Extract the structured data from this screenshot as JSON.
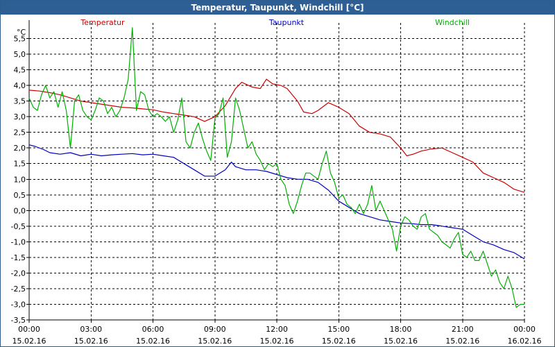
{
  "window": {
    "title": "Temperatur, Taupunkt, Windchill [°C]"
  },
  "chart_data": {
    "type": "line",
    "title": "Temperatur, Taupunkt, Windchill [°C]",
    "ylabel": "°C",
    "xlabel": "",
    "ylim": [
      -3.5,
      6.0
    ],
    "yticks": [
      "5,5",
      "5,0",
      "4,5",
      "4,0",
      "3,5",
      "3,0",
      "2,5",
      "2,0",
      "1,5",
      "1,0",
      "0,5",
      "0,0",
      "-0,5",
      "-1,0",
      "-1,5",
      "-2,0",
      "-2,5",
      "-3,0",
      "-3,5"
    ],
    "xticks": [
      {
        "time": "00:00",
        "date": "15.02.16"
      },
      {
        "time": "03:00",
        "date": "15.02.16"
      },
      {
        "time": "06:00",
        "date": "15.02.16"
      },
      {
        "time": "09:00",
        "date": "15.02.16"
      },
      {
        "time": "12:00",
        "date": "15.02.16"
      },
      {
        "time": "15:00",
        "date": "15.02.16"
      },
      {
        "time": "18:00",
        "date": "15.02.16"
      },
      {
        "time": "21:00",
        "date": "15.02.16"
      },
      {
        "time": "00:00",
        "date": "16.02.16"
      }
    ],
    "x_unit": "hours since 15.02.16 00:00",
    "grid": true,
    "legend_position": "top",
    "series": [
      {
        "name": "Temperatur",
        "color": "#cc0000",
        "points": [
          [
            0,
            3.85
          ],
          [
            0.5,
            3.82
          ],
          [
            1,
            3.77
          ],
          [
            1.5,
            3.7
          ],
          [
            2,
            3.6
          ],
          [
            2.5,
            3.5
          ],
          [
            3,
            3.45
          ],
          [
            3.5,
            3.4
          ],
          [
            4,
            3.35
          ],
          [
            4.5,
            3.3
          ],
          [
            5,
            3.28
          ],
          [
            5.5,
            3.25
          ],
          [
            6,
            3.22
          ],
          [
            6.5,
            3.15
          ],
          [
            7,
            3.1
          ],
          [
            7.5,
            3.05
          ],
          [
            8,
            3.0
          ],
          [
            8.5,
            2.85
          ],
          [
            9,
            3.0
          ],
          [
            9.5,
            3.35
          ],
          [
            10,
            3.9
          ],
          [
            10.3,
            4.1
          ],
          [
            10.8,
            3.95
          ],
          [
            11.2,
            3.9
          ],
          [
            11.5,
            4.2
          ],
          [
            11.8,
            4.05
          ],
          [
            12.2,
            4.0
          ],
          [
            12.5,
            3.9
          ],
          [
            13,
            3.5
          ],
          [
            13.3,
            3.15
          ],
          [
            13.7,
            3.1
          ],
          [
            14,
            3.2
          ],
          [
            14.5,
            3.45
          ],
          [
            15,
            3.3
          ],
          [
            15.5,
            3.1
          ],
          [
            16,
            2.7
          ],
          [
            16.5,
            2.5
          ],
          [
            17,
            2.45
          ],
          [
            17.5,
            2.35
          ],
          [
            18,
            2.0
          ],
          [
            18.3,
            1.75
          ],
          [
            18.6,
            1.8
          ],
          [
            19,
            1.9
          ],
          [
            19.5,
            1.97
          ],
          [
            20,
            2.0
          ],
          [
            20.5,
            1.85
          ],
          [
            21,
            1.7
          ],
          [
            21.5,
            1.55
          ],
          [
            22,
            1.2
          ],
          [
            22.5,
            1.05
          ],
          [
            23,
            0.9
          ],
          [
            23.5,
            0.68
          ],
          [
            24,
            0.58
          ]
        ]
      },
      {
        "name": "Taupunkt",
        "color": "#0000c0",
        "points": [
          [
            0,
            2.1
          ],
          [
            0.3,
            2.05
          ],
          [
            0.7,
            1.95
          ],
          [
            1,
            1.85
          ],
          [
            1.5,
            1.8
          ],
          [
            2,
            1.85
          ],
          [
            2.5,
            1.75
          ],
          [
            3,
            1.8
          ],
          [
            3.5,
            1.75
          ],
          [
            4,
            1.78
          ],
          [
            4.5,
            1.8
          ],
          [
            5,
            1.82
          ],
          [
            5.5,
            1.78
          ],
          [
            6,
            1.8
          ],
          [
            6.5,
            1.75
          ],
          [
            7,
            1.7
          ],
          [
            7.5,
            1.5
          ],
          [
            8,
            1.3
          ],
          [
            8.5,
            1.1
          ],
          [
            9,
            1.1
          ],
          [
            9.5,
            1.3
          ],
          [
            9.8,
            1.55
          ],
          [
            10,
            1.4
          ],
          [
            10.5,
            1.3
          ],
          [
            11,
            1.3
          ],
          [
            11.5,
            1.25
          ],
          [
            12,
            1.15
          ],
          [
            12.5,
            1.05
          ],
          [
            13,
            1.0
          ],
          [
            13.5,
            1.0
          ],
          [
            14,
            0.9
          ],
          [
            14.5,
            0.65
          ],
          [
            15,
            0.3
          ],
          [
            15.5,
            0.1
          ],
          [
            16,
            -0.1
          ],
          [
            16.5,
            -0.2
          ],
          [
            17,
            -0.3
          ],
          [
            17.5,
            -0.35
          ],
          [
            18,
            -0.4
          ],
          [
            18.5,
            -0.42
          ],
          [
            19,
            -0.45
          ],
          [
            19.5,
            -0.45
          ],
          [
            20,
            -0.5
          ],
          [
            20.5,
            -0.55
          ],
          [
            21,
            -0.6
          ],
          [
            21.5,
            -0.8
          ],
          [
            22,
            -1.0
          ],
          [
            22.5,
            -1.1
          ],
          [
            23,
            -1.25
          ],
          [
            23.5,
            -1.35
          ],
          [
            24,
            -1.55
          ]
        ]
      },
      {
        "name": "Windchill",
        "color": "#00b000",
        "points": [
          [
            0,
            3.6
          ],
          [
            0.2,
            3.3
          ],
          [
            0.4,
            3.2
          ],
          [
            0.6,
            3.7
          ],
          [
            0.8,
            4.0
          ],
          [
            1,
            3.6
          ],
          [
            1.2,
            3.8
          ],
          [
            1.4,
            3.3
          ],
          [
            1.6,
            3.8
          ],
          [
            1.8,
            3.2
          ],
          [
            2,
            2.0
          ],
          [
            2.2,
            3.5
          ],
          [
            2.4,
            3.7
          ],
          [
            2.6,
            3.2
          ],
          [
            2.8,
            3.0
          ],
          [
            3,
            2.9
          ],
          [
            3.2,
            3.2
          ],
          [
            3.4,
            3.6
          ],
          [
            3.6,
            3.5
          ],
          [
            3.8,
            3.1
          ],
          [
            4,
            3.3
          ],
          [
            4.2,
            3.0
          ],
          [
            4.4,
            3.2
          ],
          [
            4.6,
            3.6
          ],
          [
            4.8,
            4.2
          ],
          [
            5,
            5.85
          ],
          [
            5.2,
            3.2
          ],
          [
            5.4,
            3.8
          ],
          [
            5.6,
            3.7
          ],
          [
            5.8,
            3.2
          ],
          [
            6,
            3.0
          ],
          [
            6.2,
            3.1
          ],
          [
            6.4,
            3.0
          ],
          [
            6.6,
            2.85
          ],
          [
            6.8,
            3.0
          ],
          [
            7,
            2.5
          ],
          [
            7.2,
            2.9
          ],
          [
            7.4,
            3.6
          ],
          [
            7.6,
            2.2
          ],
          [
            7.8,
            2.0
          ],
          [
            8,
            2.5
          ],
          [
            8.2,
            2.8
          ],
          [
            8.4,
            2.3
          ],
          [
            8.6,
            1.9
          ],
          [
            8.8,
            1.6
          ],
          [
            9,
            2.95
          ],
          [
            9.2,
            3.1
          ],
          [
            9.4,
            3.6
          ],
          [
            9.6,
            1.7
          ],
          [
            9.8,
            2.2
          ],
          [
            10,
            3.6
          ],
          [
            10.2,
            3.2
          ],
          [
            10.4,
            2.6
          ],
          [
            10.6,
            2.0
          ],
          [
            10.8,
            2.2
          ],
          [
            11,
            1.8
          ],
          [
            11.2,
            1.6
          ],
          [
            11.4,
            1.3
          ],
          [
            11.6,
            1.5
          ],
          [
            11.8,
            1.4
          ],
          [
            12,
            1.5
          ],
          [
            12.2,
            1.0
          ],
          [
            12.4,
            0.8
          ],
          [
            12.6,
            0.2
          ],
          [
            12.8,
            -0.1
          ],
          [
            13,
            0.3
          ],
          [
            13.2,
            0.8
          ],
          [
            13.4,
            1.2
          ],
          [
            13.6,
            1.2
          ],
          [
            13.8,
            1.1
          ],
          [
            14,
            1.0
          ],
          [
            14.2,
            1.5
          ],
          [
            14.4,
            1.9
          ],
          [
            14.6,
            1.2
          ],
          [
            14.8,
            0.9
          ],
          [
            15,
            0.4
          ],
          [
            15.2,
            0.5
          ],
          [
            15.4,
            0.2
          ],
          [
            15.6,
            0.1
          ],
          [
            15.8,
            -0.1
          ],
          [
            16,
            0.2
          ],
          [
            16.2,
            -0.1
          ],
          [
            16.4,
            0.2
          ],
          [
            16.6,
            0.8
          ],
          [
            16.8,
            0.0
          ],
          [
            17,
            0.3
          ],
          [
            17.2,
            0.0
          ],
          [
            17.4,
            -0.3
          ],
          [
            17.6,
            -0.6
          ],
          [
            17.8,
            -1.3
          ],
          [
            18,
            -0.5
          ],
          [
            18.2,
            -0.2
          ],
          [
            18.4,
            -0.3
          ],
          [
            18.6,
            -0.5
          ],
          [
            18.8,
            -0.6
          ],
          [
            19,
            -0.2
          ],
          [
            19.2,
            -0.1
          ],
          [
            19.4,
            -0.6
          ],
          [
            19.6,
            -0.7
          ],
          [
            19.8,
            -0.8
          ],
          [
            20,
            -1.0
          ],
          [
            20.2,
            -1.1
          ],
          [
            20.4,
            -1.2
          ],
          [
            20.6,
            -0.9
          ],
          [
            20.8,
            -0.7
          ],
          [
            21,
            -1.4
          ],
          [
            21.2,
            -1.5
          ],
          [
            21.4,
            -1.3
          ],
          [
            21.6,
            -1.6
          ],
          [
            21.8,
            -1.6
          ],
          [
            22,
            -1.3
          ],
          [
            22.2,
            -1.7
          ],
          [
            22.4,
            -2.1
          ],
          [
            22.6,
            -1.9
          ],
          [
            22.8,
            -2.3
          ],
          [
            23,
            -2.5
          ],
          [
            23.2,
            -2.1
          ],
          [
            23.4,
            -2.5
          ],
          [
            23.6,
            -3.1
          ],
          [
            23.8,
            -3.0
          ],
          [
            24,
            -3.0
          ]
        ]
      }
    ]
  }
}
